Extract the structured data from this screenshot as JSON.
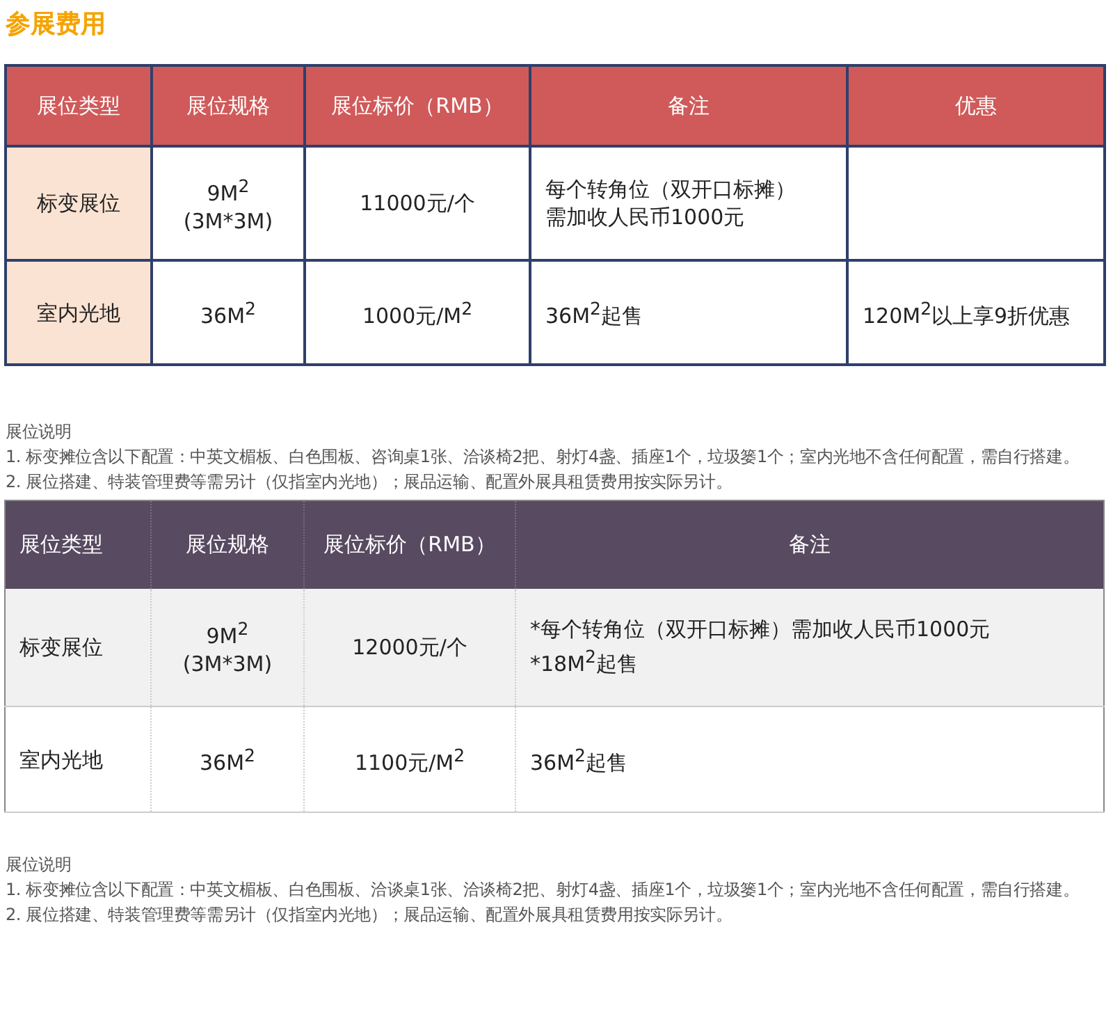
{
  "title": "参展费用",
  "sections": [
    {
      "table": {
        "kind": "bordered",
        "columns": [
          "展位类型",
          "展位规格",
          "展位标价（RMB）",
          "备注",
          "优惠"
        ],
        "rows": [
          [
            "标变展位",
            "9M$^{2}$\n(3M*3M)",
            "11000元/个",
            "每个转角位（双开口标摊）需加收人民币1000元",
            ""
          ],
          [
            "室内光地",
            "36M$^{2}$",
            "1000元/M$^{2}$",
            "36M$^{2}$起售",
            "120M$^{2}$以上享9折优惠"
          ]
        ]
      },
      "notes": {
        "heading": "展位说明",
        "items": [
          "1. 标变摊位含以下配置：中英文楣板、白色围板、咨询桌1张、洽谈椅2把、射灯4盏、插座1个，垃圾篓1个；室内光地不含任何配置，需自行搭建。",
          "2. 展位搭建、特装管理费等需另计（仅指室内光地）；展品运输、配置外展具租赁费用按实际另计。"
        ]
      }
    },
    {
      "table": {
        "kind": "striped",
        "columns": [
          "展位类型",
          "展位规格",
          "展位标价（RMB）",
          "备注"
        ],
        "rows": [
          [
            "标变展位",
            "9M$^{2}$\n(3M*3M)",
            "12000元/个",
            [
              "*每个转角位（双开口标摊）需加收人民币1000元",
              "*18M$^{2}$起售"
            ]
          ],
          [
            "室内光地",
            "36M$^{2}$",
            "1100元/M$^{2}$",
            "36M$^{2}$起售"
          ]
        ]
      },
      "notes": {
        "heading": "展位说明",
        "items": [
          "1. 标变摊位含以下配置：中英文楣板、白色围板、洽谈桌1张、洽谈椅2把、射灯4盏、插座1个，垃圾篓1个；室内光地不含任何配置，需自行搭建。",
          "2. 展位搭建、特装管理费等需另计（仅指室内光地）；展品运输、配置外展具租赁费用按实际另计。"
        ]
      }
    }
  ]
}
